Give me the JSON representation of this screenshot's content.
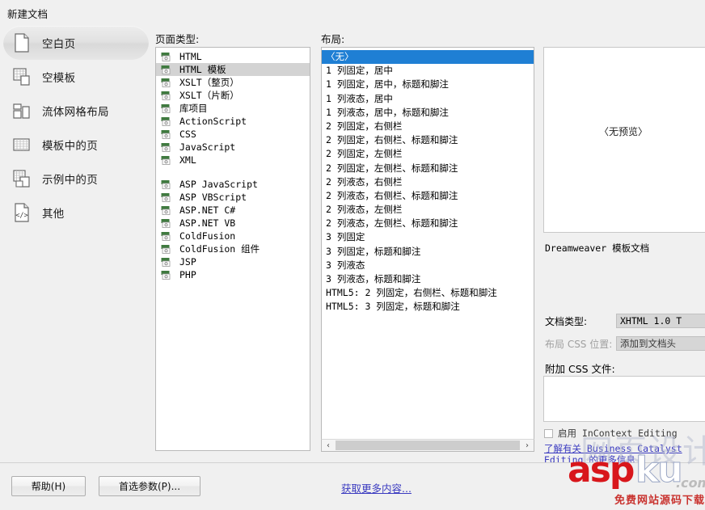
{
  "window": {
    "title": "新建文档"
  },
  "sidebar": {
    "items": [
      {
        "label": "空白页",
        "icon": "blank-page-icon",
        "selected": true
      },
      {
        "label": "空模板",
        "icon": "blank-template-icon",
        "selected": false
      },
      {
        "label": "流体网格布局",
        "icon": "fluid-grid-icon",
        "selected": false
      },
      {
        "label": "模板中的页",
        "icon": "page-from-template-icon",
        "selected": false
      },
      {
        "label": "示例中的页",
        "icon": "page-from-sample-icon",
        "selected": false
      },
      {
        "label": "其他",
        "icon": "other-code-icon",
        "selected": false
      }
    ]
  },
  "pagetype": {
    "heading": "页面类型:",
    "items": [
      {
        "label": "HTML",
        "selected": false,
        "spacer": false
      },
      {
        "label": "HTML 模板",
        "selected": true,
        "spacer": false
      },
      {
        "label": "XSLT（整页）",
        "selected": false,
        "spacer": false
      },
      {
        "label": "XSLT（片断）",
        "selected": false,
        "spacer": false
      },
      {
        "label": "库项目",
        "selected": false,
        "spacer": false
      },
      {
        "label": "ActionScript",
        "selected": false,
        "spacer": false
      },
      {
        "label": "CSS",
        "selected": false,
        "spacer": false
      },
      {
        "label": "JavaScript",
        "selected": false,
        "spacer": false
      },
      {
        "label": "XML",
        "selected": false,
        "spacer": false
      },
      {
        "label": "",
        "selected": false,
        "spacer": true
      },
      {
        "label": "ASP JavaScript",
        "selected": false,
        "spacer": false
      },
      {
        "label": "ASP VBScript",
        "selected": false,
        "spacer": false
      },
      {
        "label": "ASP.NET C#",
        "selected": false,
        "spacer": false
      },
      {
        "label": "ASP.NET VB",
        "selected": false,
        "spacer": false
      },
      {
        "label": "ColdFusion",
        "selected": false,
        "spacer": false
      },
      {
        "label": "ColdFusion 组件",
        "selected": false,
        "spacer": false
      },
      {
        "label": "JSP",
        "selected": false,
        "spacer": false
      },
      {
        "label": "PHP",
        "selected": false,
        "spacer": false
      }
    ]
  },
  "layout": {
    "heading": "布局:",
    "items": [
      {
        "label": "〈无〉",
        "selected": true
      },
      {
        "label": "1 列固定，居中",
        "selected": false
      },
      {
        "label": "1 列固定，居中，标题和脚注",
        "selected": false
      },
      {
        "label": "1 列液态，居中",
        "selected": false
      },
      {
        "label": "1 列液态，居中，标题和脚注",
        "selected": false
      },
      {
        "label": "2 列固定，右侧栏",
        "selected": false
      },
      {
        "label": "2 列固定，右侧栏、标题和脚注",
        "selected": false
      },
      {
        "label": "2 列固定，左侧栏",
        "selected": false
      },
      {
        "label": "2 列固定，左侧栏、标题和脚注",
        "selected": false
      },
      {
        "label": "2 列液态，右侧栏",
        "selected": false
      },
      {
        "label": "2 列液态，右侧栏、标题和脚注",
        "selected": false
      },
      {
        "label": "2 列液态，左侧栏",
        "selected": false
      },
      {
        "label": "2 列液态，左侧栏、标题和脚注",
        "selected": false
      },
      {
        "label": "3 列固定",
        "selected": false
      },
      {
        "label": "3 列固定，标题和脚注",
        "selected": false
      },
      {
        "label": "3 列液态",
        "selected": false
      },
      {
        "label": "3 列液态，标题和脚注",
        "selected": false
      },
      {
        "label": "HTML5: 2 列固定，右侧栏、标题和脚注",
        "selected": false
      },
      {
        "label": "HTML5: 3 列固定，标题和脚注",
        "selected": false
      }
    ],
    "scrollbar": {
      "left_arrow": "‹",
      "right_arrow": "›"
    }
  },
  "preview": {
    "placeholder": "〈无预览〉",
    "description": "Dreamweaver 模板文档",
    "doctype_label": "文档类型:",
    "doctype_value": "XHTML 1.0 T",
    "csslayout_label": "布局 CSS 位置:",
    "csslayout_value": "添加到文档头",
    "attach_css_label": "附加 CSS 文件:",
    "incontext_checkbox_label": "启用 InContext Editing",
    "incontext_checked": false,
    "incontext_link": "了解有关 Business Catalyst Editing 的更多信息"
  },
  "footer": {
    "help_button": "帮助(H)",
    "prefs_button": "首选参数(P)...",
    "more_link": "获取更多内容..."
  },
  "watermark": {
    "asp": "asp",
    "ku": "ku",
    "com": ".com",
    "sub": "免费网站源码下载站",
    "ghost": "网页设计"
  },
  "colors": {
    "selection_blue": "#1f7fd4",
    "selection_gray": "#d3d3d3",
    "dialog_bg": "#f0f0f0",
    "link": "#3a3ac0",
    "watermark_red": "#d8161b"
  }
}
